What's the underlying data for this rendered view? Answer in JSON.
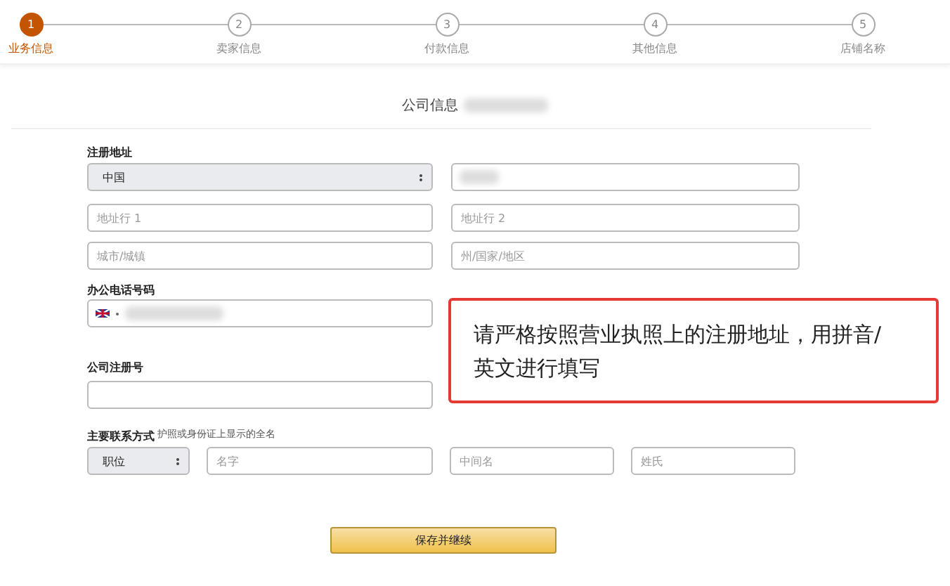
{
  "steps": [
    {
      "number": "1",
      "label": "业务信息",
      "selected": true
    },
    {
      "number": "2",
      "label": "卖家信息",
      "selected": false
    },
    {
      "number": "3",
      "label": "付款信息",
      "selected": false
    },
    {
      "number": "4",
      "label": "其他信息",
      "selected": false
    },
    {
      "number": "5",
      "label": "店铺名称",
      "selected": false
    }
  ],
  "heading": "公司信息",
  "address": {
    "label": "注册地址",
    "country": "中国",
    "line1_placeholder": "地址行 1",
    "line2_placeholder": "地址行 2",
    "city_placeholder": "城市/城镇",
    "state_placeholder": "州/国家/地区"
  },
  "phone": {
    "label": "办公电话号码"
  },
  "registration": {
    "label": "公司注册号"
  },
  "contact": {
    "label": "主要联系方式",
    "hint": "护照或身份证上显示的全名",
    "title": "职位",
    "first_placeholder": "名字",
    "middle_placeholder": "中间名",
    "last_placeholder": "姓氏"
  },
  "submit": "保存并继续",
  "callout": "请严格按照营业执照上的注册地址，用拼音/英文进行填写"
}
